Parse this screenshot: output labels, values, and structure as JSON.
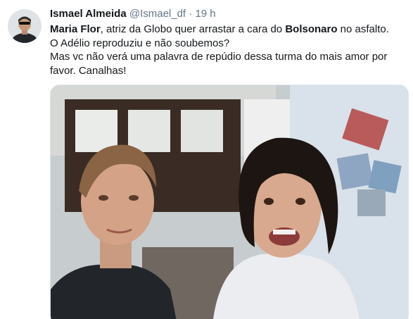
{
  "author": {
    "name": "Ismael Almeida",
    "handle": "@Ismael_df",
    "separator": "·",
    "time": "19 h",
    "avatar_icon": "profile-photo"
  },
  "tweet": {
    "line1_part1": "Maria Flor",
    "line1_part2": ", atriz da Globo quer arrastar a cara do ",
    "line1_part3": "Bolsonaro",
    "line1_part4": " no asfalto.",
    "line2": "O Adélio reproduziu e não soubemos?",
    "line3": "Mas vc não verá uma palavra de repúdio dessa turma do mais amor por",
    "line4": "favor. Canalhas!"
  },
  "colors": {
    "name": "#14171a",
    "secondary": "#657786",
    "border": "#e1e8ed"
  }
}
